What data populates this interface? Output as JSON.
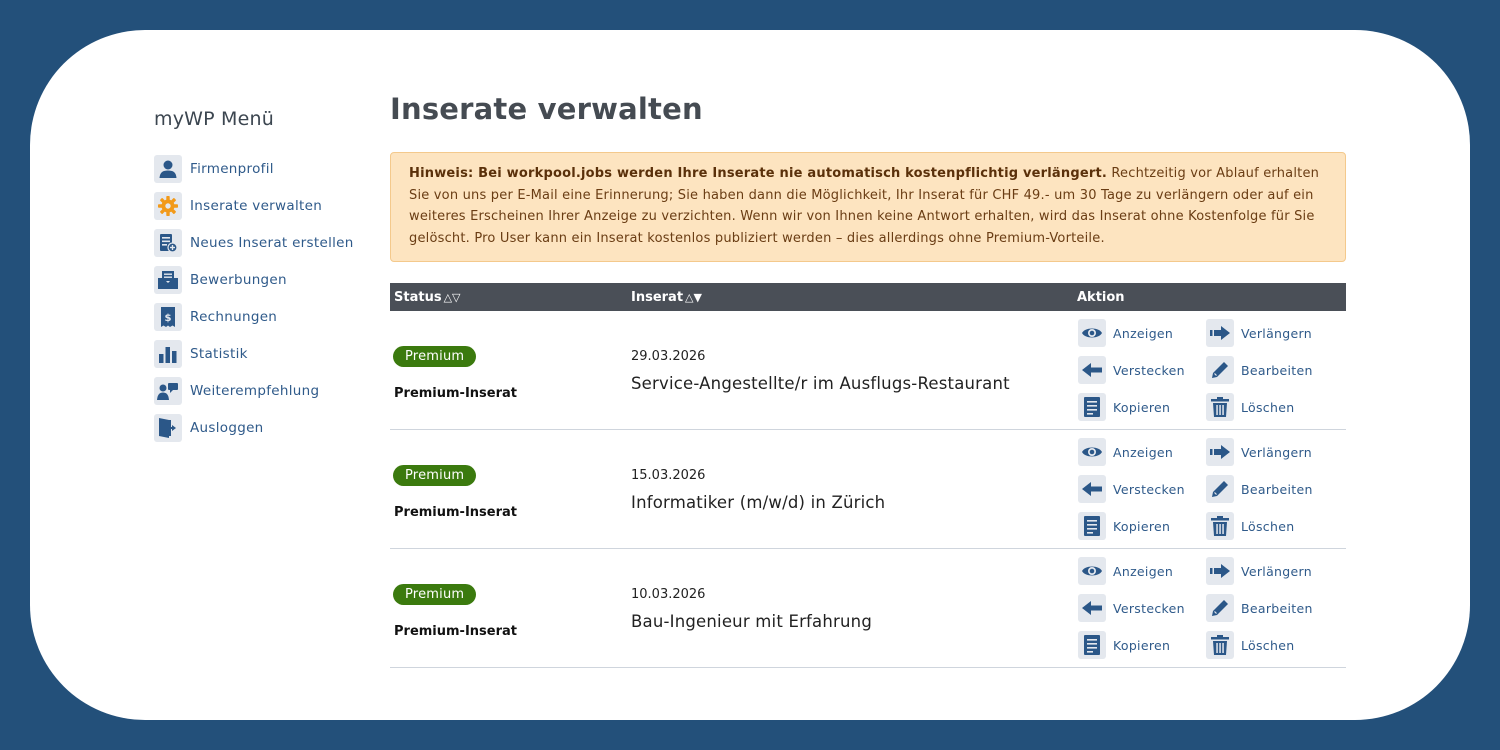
{
  "sidebar": {
    "title": "myWP Menü",
    "items": [
      {
        "label": "Firmenprofil",
        "icon": "person-icon"
      },
      {
        "label": "Inserate verwalten",
        "icon": "gear-icon"
      },
      {
        "label": "Neues Inserat erstellen",
        "icon": "new-document-icon"
      },
      {
        "label": "Bewerbungen",
        "icon": "inbox-icon"
      },
      {
        "label": "Rechnungen",
        "icon": "invoice-icon"
      },
      {
        "label": "Statistik",
        "icon": "bar-chart-icon"
      },
      {
        "label": "Weiterempfehlung",
        "icon": "refer-icon"
      },
      {
        "label": "Ausloggen",
        "icon": "logout-icon"
      }
    ]
  },
  "main": {
    "title": "Inserate verwalten",
    "notice": {
      "bold": "Hinweis: Bei workpool.jobs werden Ihre Inserate nie automatisch kostenpflichtig verlängert.",
      "text": " Rechtzeitig vor Ablauf erhalten Sie von uns per E-Mail eine Erinnerung; Sie haben dann die Möglichkeit, Ihr Inserat für CHF 49.- um 30 Tage zu verlängern oder auf ein weiteres Erscheinen Ihrer Anzeige zu verzichten. Wenn wir von Ihnen keine Antwort erhalten, wird das Inserat ohne Kostenfolge für Sie gelöscht. Pro User kann ein Inserat kostenlos publiziert werden – dies allerdings ohne Premium-Vorteile."
    },
    "table": {
      "headers": {
        "status": "Status",
        "status_sort": "△▽",
        "inserat": "Inserat",
        "inserat_sort": "△▼",
        "aktion": "Aktion"
      },
      "actions": {
        "show": "Anzeigen",
        "extend": "Verlängern",
        "hide": "Verstecken",
        "edit": "Bearbeiten",
        "copy": "Kopieren",
        "delete": "Löschen"
      },
      "rows": [
        {
          "badge": "Premium",
          "status": "Premium-Inserat",
          "date": "29.03.2026",
          "title": "Service-Angestellte/r im Ausflugs-Restaurant"
        },
        {
          "badge": "Premium",
          "status": "Premium-Inserat",
          "date": "15.03.2026",
          "title": "Informatiker (m/w/d) in Zürich"
        },
        {
          "badge": "Premium",
          "status": "Premium-Inserat",
          "date": "10.03.2026",
          "title": "Bau-Ingenieur mit Erfahrung"
        }
      ]
    }
  },
  "colors": {
    "frame": "#23507a",
    "accent": "#2f5a8a",
    "badge": "#3b7a0e",
    "notice_bg": "#fde4c0",
    "table_header": "#4a4f57"
  }
}
